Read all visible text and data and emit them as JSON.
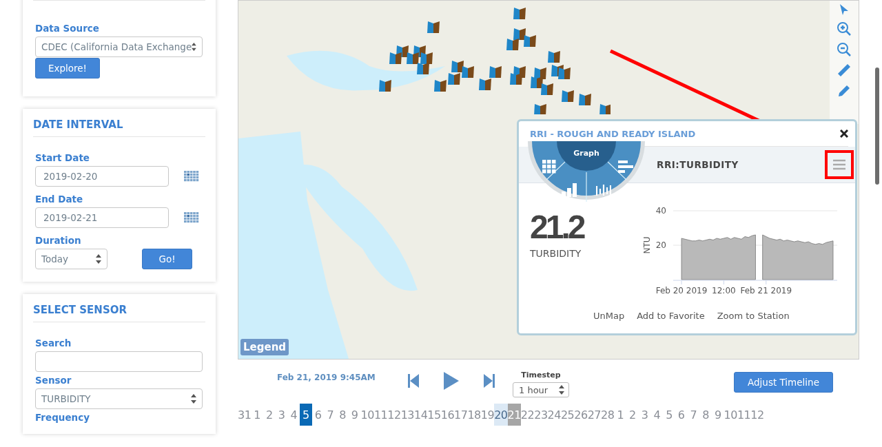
{
  "sidebar": {
    "data_source": {
      "label": "Data Source",
      "value": "CDEC (California Data Exchange",
      "button": "Explore!"
    },
    "date_interval": {
      "title": "DATE INTERVAL",
      "start_label": "Start Date",
      "start_value": "2019-02-20",
      "end_label": "End Date",
      "end_value": "2019-02-21",
      "duration_label": "Duration",
      "duration_value": "Today",
      "button": "Go!"
    },
    "select_sensor": {
      "title": "SELECT SENSOR",
      "search_label": "Search",
      "sensor_label": "Sensor",
      "sensor_value": "TURBIDITY",
      "frequency_label": "Frequency"
    }
  },
  "map": {
    "legend": "Legend",
    "popup": {
      "title": "RRI - ROUGH AND READY ISLAND",
      "wheel_label": "Graph",
      "sensor_title": "RRI:TURBIDITY",
      "value": "21.2",
      "value_label": "TURBIDITY",
      "chart_data": {
        "type": "area",
        "ylabel": "NTU",
        "categories": [
          "Feb 20 2019",
          null,
          null,
          null,
          null,
          null,
          null,
          null,
          null,
          null,
          null,
          null,
          "12:00",
          null,
          null,
          null,
          null,
          null,
          null,
          null,
          null,
          null,
          null,
          null,
          "Feb 21 2019",
          null,
          null,
          null,
          null,
          null,
          null,
          null,
          null,
          null,
          null,
          null,
          null,
          null,
          null,
          null,
          null,
          null,
          null,
          null
        ],
        "series": [
          {
            "color": "#b9b9b9",
            "values": [
              24,
              23.5,
              23,
              22.5,
              22.5,
              23,
              22.5,
              23,
              23.5,
              23,
              24,
              23.5,
              24,
              24.5,
              23.5,
              24.5,
              24,
              23.5,
              25,
              24.5,
              25.5,
              26,
              null,
              26,
              25,
              24,
              23.5,
              23,
              23.5,
              22.5,
              23,
              22.5,
              22,
              22.5,
              22,
              21.5,
              22,
              21,
              20.5,
              21,
              20.5,
              21.5,
              22,
              22.5
            ]
          }
        ],
        "ylim": [
          0,
          40
        ],
        "yticks": [
          20,
          40
        ]
      },
      "links": [
        "UnMap",
        "Add to Favorite",
        "Zoom to Station"
      ]
    }
  },
  "timeline": {
    "current": "Feb 21, 2019 9:45AM",
    "timestep_label": "Timestep",
    "timestep_value": "1 hour",
    "adjust_button": "Adjust Timeline",
    "days": [
      {
        "label": "31",
        "selected": false
      },
      {
        "label": "1",
        "selected": false
      },
      {
        "label": "2",
        "selected": false
      },
      {
        "label": "3",
        "selected": false
      },
      {
        "label": "4",
        "selected": false
      },
      {
        "label": "5",
        "selected": true
      },
      {
        "label": "6",
        "selected": false
      },
      {
        "label": "7",
        "selected": false
      },
      {
        "label": "8",
        "selected": false
      },
      {
        "label": "9",
        "selected": false
      },
      {
        "label": "10",
        "selected": false
      },
      {
        "label": "11",
        "selected": false
      },
      {
        "label": "12",
        "selected": false
      },
      {
        "label": "13",
        "selected": false
      },
      {
        "label": "14",
        "selected": false
      },
      {
        "label": "15",
        "selected": false
      },
      {
        "label": "16",
        "selected": false
      },
      {
        "label": "17",
        "selected": false
      },
      {
        "label": "18",
        "selected": false
      },
      {
        "label": "19",
        "selected": false
      },
      {
        "label": "20",
        "selected": false,
        "color": "#dce9f5"
      },
      {
        "label": "21",
        "selected": false,
        "color": "#a6a6a6"
      },
      {
        "label": "22",
        "selected": false
      },
      {
        "label": "23",
        "selected": false
      },
      {
        "label": "24",
        "selected": false
      },
      {
        "label": "25",
        "selected": false
      },
      {
        "label": "26",
        "selected": false
      },
      {
        "label": "27",
        "selected": false
      },
      {
        "label": "28",
        "selected": false
      },
      {
        "label": "1",
        "selected": false
      },
      {
        "label": "2",
        "selected": false
      },
      {
        "label": "3",
        "selected": false
      },
      {
        "label": "4",
        "selected": false
      },
      {
        "label": "5",
        "selected": false
      },
      {
        "label": "6",
        "selected": false
      },
      {
        "label": "7",
        "selected": false
      },
      {
        "label": "8",
        "selected": false
      },
      {
        "label": "9",
        "selected": false
      },
      {
        "label": "10",
        "selected": false
      },
      {
        "label": "11",
        "selected": false
      },
      {
        "label": "12",
        "selected": false
      }
    ]
  }
}
